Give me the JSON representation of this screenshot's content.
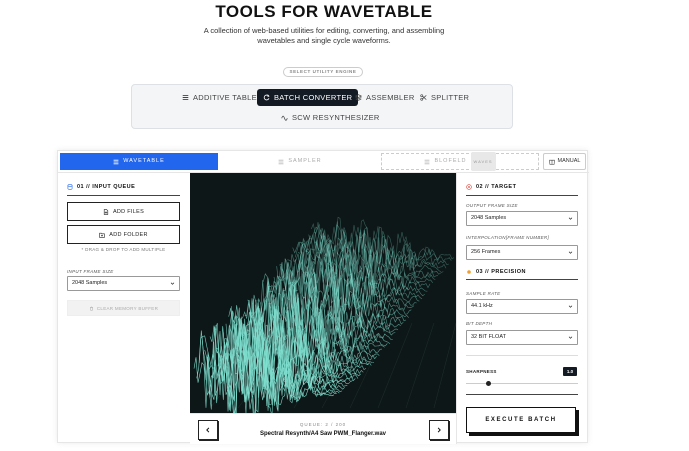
{
  "header": {
    "title": "TOOLS FOR WAVETABLE",
    "description": "A collection of web-based utilities for editing, converting, and assembling wavetables and single cycle waveforms.",
    "engine_label": "SELECT UTILITY ENGINE"
  },
  "engines": [
    {
      "label": "ADDITIVE TABLE",
      "icon": "bars-icon"
    },
    {
      "label": "BATCH CONVERTER",
      "icon": "refresh-icon",
      "active": true
    },
    {
      "label": "ASSEMBLER",
      "icon": "layers-icon"
    },
    {
      "label": "SPLITTER",
      "icon": "scissors-icon"
    },
    {
      "label": "SCW RESYNTHESIZER",
      "icon": "wave-icon"
    }
  ],
  "tabs": [
    {
      "label": "WAVETABLE",
      "active": true
    },
    {
      "label": "SAMPLER"
    },
    {
      "label": "BLOFELD",
      "badge": "WAVES"
    },
    {
      "label": "MANUAL"
    }
  ],
  "input_queue": {
    "title": "01 // INPUT QUEUE",
    "add_files": "ADD FILES",
    "add_folder": "ADD FOLDER",
    "hint": "* DRAG & DROP TO ADD MULTIPLE",
    "frame_size_label": "INPUT FRAME SIZE",
    "frame_size_value": "2048 Samples",
    "clear_label": "CLEAR MEMORY BUFFER"
  },
  "preview": {
    "queue_label": "QUEUE: 2 / 200",
    "file_name": "Spectral Resynth/A4 Saw PWM_Flanger.wav"
  },
  "target": {
    "title": "02 // TARGET",
    "output_frame_label": "OUTPUT FRAME SIZE",
    "output_frame_value": "2048 Samples",
    "interp_label": "INTERPOLATION[FRAME NUMBER]",
    "interp_value": "256 Frames"
  },
  "precision": {
    "title": "03 // PRECISION",
    "sample_rate_label": "SAMPLE RATE",
    "sample_rate_value": "44.1 kHz",
    "bit_depth_label": "BIT DEPTH",
    "bit_depth_value": "32 BIT FLOAT",
    "sharpness_label": "SHARPNESS",
    "sharpness_value": "1.0",
    "sharpness_fraction": 0.2
  },
  "execute_label": "EXECUTE BATCH",
  "colors": {
    "accent": "#2266ee",
    "dark": "#131a24",
    "viz_bg": "#0e1717",
    "wave": "#7fe0d0"
  }
}
